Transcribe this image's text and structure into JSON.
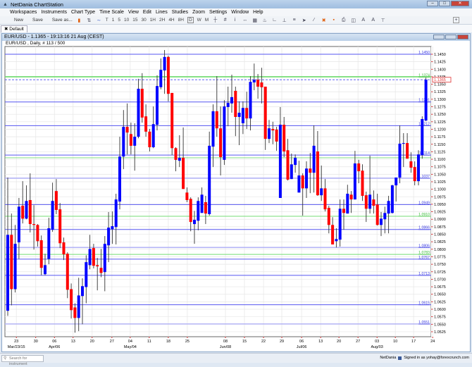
{
  "window": {
    "title": "NetDania ChartStation"
  },
  "menu": [
    "Workspaces",
    "Instruments",
    "Chart Type",
    "Time Scale",
    "View",
    "Edit",
    "Lines",
    "Studies",
    "Zoom",
    "Settings",
    "Window",
    "Help"
  ],
  "toolbar": {
    "new": "New",
    "save": "Save",
    "save_as": "Save as...",
    "timescales": [
      "T",
      "1",
      "5",
      "10",
      "15",
      "30",
      "1H",
      "2H",
      "4H",
      "8H",
      "D",
      "W",
      "M"
    ],
    "selected_timescale": "D"
  },
  "tab": {
    "label": "Default"
  },
  "chart_window": {
    "title": "EUR/USD - 1.1365 - 19:13:16  21 Aug (CEST)",
    "subtitle": "EUR/USD , Daily, # 113 / 500"
  },
  "status": {
    "search_placeholder": "Search for instrument",
    "brand": "NetDania",
    "signed_in": "Signed in as yohay@forexcrunch.com"
  },
  "colors": {
    "up": "#0000ff",
    "down": "#ff0000",
    "level": "#5c5cf0",
    "green_level": "#7ee07e",
    "grid": "#e6e6e6"
  },
  "chart_data": {
    "type": "candlestick",
    "instrument": "EUR/USD",
    "ylim": [
      1.0515,
      1.148
    ],
    "yticks": [
      "1.1450",
      "1.1425",
      "1.1400",
      "1.1375",
      "1.1350",
      "1.1325",
      "1.1300",
      "1.1275",
      "1.1250",
      "1.1225",
      "1.1200",
      "1.1175",
      "1.1150",
      "1.1125",
      "1.1100",
      "1.1075",
      "1.1050",
      "1.1025",
      "1.1000",
      "1.0975",
      "1.0950",
      "1.0925",
      "1.0900",
      "1.0875",
      "1.0850",
      "1.0825",
      "1.0800",
      "1.0775",
      "1.0750",
      "1.0725",
      "1.0700",
      "1.0675",
      "1.0650",
      "1.0625",
      "1.0600",
      "1.0575",
      "1.0550",
      "1.0525"
    ],
    "current_price": "1.1365",
    "levels": [
      {
        "value": "1.1450",
        "color": "blue"
      },
      {
        "value": "1.1374",
        "color": "green"
      },
      {
        "value": "1.1291",
        "color": "blue"
      },
      {
        "value": "1.1212",
        "color": "blue"
      },
      {
        "value": "1.1114",
        "color": "blue"
      },
      {
        "value": "1.1037",
        "color": "lightblue"
      },
      {
        "value": "1.0949",
        "color": "blue"
      },
      {
        "value": "1.0910",
        "color": "green"
      },
      {
        "value": "1.0866",
        "color": "blue"
      },
      {
        "value": "1.0806",
        "color": "lightblue"
      },
      {
        "value": "1.0783",
        "color": "green"
      },
      {
        "value": "1.0767",
        "color": "blue"
      },
      {
        "value": "1.0713",
        "color": "blue"
      },
      {
        "value": "1.0615",
        "color": "blue"
      },
      {
        "value": "1.0551",
        "color": "lightblue"
      }
    ],
    "xticks": [
      {
        "i": 2.3,
        "label": "23",
        "sub": "Mar/23/15"
      },
      {
        "i": 7.5,
        "label": "30"
      },
      {
        "i": 12.5,
        "label": "06",
        "sub": "Apr/06"
      },
      {
        "i": 17.5,
        "label": "13"
      },
      {
        "i": 22.6,
        "label": "20"
      },
      {
        "i": 27.9,
        "label": "27"
      },
      {
        "i": 32.8,
        "label": "04",
        "sub": "May/04"
      },
      {
        "i": 37.9,
        "label": "11"
      },
      {
        "i": 43,
        "label": "18"
      },
      {
        "i": 48.1,
        "label": "25"
      },
      {
        "i": 58.3,
        "label": "08",
        "sub": "Jun/08"
      },
      {
        "i": 63.4,
        "label": "15"
      },
      {
        "i": 68.5,
        "label": "22"
      },
      {
        "i": 73.4,
        "label": "29"
      },
      {
        "i": 78.7,
        "label": "06",
        "sub": "Jul/06"
      },
      {
        "i": 83.8,
        "label": "13"
      },
      {
        "i": 88.7,
        "label": "20"
      },
      {
        "i": 93.8,
        "label": "27"
      },
      {
        "i": 98.9,
        "label": "03",
        "sub": "Aug/03"
      },
      {
        "i": 103.8,
        "label": "10"
      },
      {
        "i": 108.7,
        "label": "17"
      },
      {
        "i": 113.8,
        "label": "24"
      }
    ],
    "ohlc": [
      [
        1.0595,
        1.1039,
        1.0578,
        1.0848
      ],
      [
        1.0848,
        1.0919,
        1.0613,
        1.0667
      ],
      [
        1.0667,
        1.0881,
        1.0656,
        1.0818
      ],
      [
        1.0823,
        1.0971,
        1.0768,
        1.0942
      ],
      [
        1.0945,
        1.1027,
        1.0886,
        1.0902
      ],
      [
        1.0902,
        1.1013,
        1.09,
        1.0961
      ],
      [
        1.0964,
        1.1053,
        1.0856,
        1.0884
      ],
      [
        1.0884,
        1.0947,
        1.0799,
        1.0881
      ],
      [
        1.0881,
        1.0884,
        1.0809,
        1.0827
      ],
      [
        1.083,
        1.0846,
        1.0714,
        1.0738
      ],
      [
        1.0717,
        1.0785,
        1.0714,
        1.0747
      ],
      [
        1.0768,
        1.0905,
        1.075,
        1.087
      ],
      [
        1.0865,
        1.1022,
        1.0858,
        1.0961
      ],
      [
        1.0994,
        1.1034,
        1.0917,
        1.0931
      ],
      [
        1.0933,
        1.0954,
        1.0804,
        1.082
      ],
      [
        1.0823,
        1.0839,
        1.0764,
        1.0783
      ],
      [
        1.0785,
        1.079,
        1.0637,
        1.0665
      ],
      [
        1.0667,
        1.0686,
        1.0569,
        1.0597
      ],
      [
        1.0606,
        1.062,
        1.0522,
        1.0571
      ],
      [
        1.0571,
        1.0705,
        1.0527,
        1.0646
      ],
      [
        1.0644,
        1.0703,
        1.055,
        1.0677
      ],
      [
        1.0674,
        1.078,
        1.062,
        1.0757
      ],
      [
        1.0747,
        1.0848,
        1.0733,
        1.0801
      ],
      [
        1.0804,
        1.0818,
        1.0736,
        1.0745
      ],
      [
        1.0747,
        1.0771,
        1.0663,
        1.0743
      ],
      [
        1.0738,
        1.0801,
        1.0707,
        1.0721
      ],
      [
        1.0724,
        1.0844,
        1.066,
        1.0818
      ],
      [
        1.0813,
        1.0924,
        1.0757,
        1.0872
      ],
      [
        1.0867,
        1.0926,
        1.0818,
        1.0877
      ],
      [
        1.0874,
        1.0985,
        1.0816,
        1.0966
      ],
      [
        1.0959,
        1.1175,
        1.0933,
        1.1109
      ],
      [
        1.1109,
        1.1264,
        1.1067,
        1.1208
      ],
      [
        1.1208,
        1.1286,
        1.1116,
        1.1189
      ],
      [
        1.1184,
        1.1222,
        1.1116,
        1.1145
      ],
      [
        1.1145,
        1.122,
        1.1062,
        1.1175
      ],
      [
        1.1175,
        1.1368,
        1.117,
        1.1335
      ],
      [
        1.1335,
        1.1387,
        1.1222,
        1.1239
      ],
      [
        1.1243,
        1.1283,
        1.1175,
        1.1192
      ],
      [
        1.1192,
        1.1201,
        1.1126,
        1.114
      ],
      [
        1.114,
        1.1276,
        1.1137,
        1.1217
      ],
      [
        1.1215,
        1.138,
        1.1196,
        1.1344
      ],
      [
        1.134,
        1.1436,
        1.1333,
        1.1398
      ],
      [
        1.1396,
        1.1464,
        1.1318,
        1.1441
      ],
      [
        1.1441,
        1.1445,
        1.1293,
        1.1318
      ],
      [
        1.1321,
        1.1321,
        1.1114,
        1.1137
      ],
      [
        1.1137,
        1.114,
        1.106,
        1.1098
      ],
      [
        1.1095,
        1.118,
        1.1074,
        1.1105
      ],
      [
        1.1105,
        1.1206,
        1.1001,
        1.1001
      ],
      [
        1.0989,
        1.1006,
        1.0957,
        1.0964
      ],
      [
        1.0968,
        1.0973,
        1.086,
        1.0891
      ],
      [
        1.0884,
        1.0928,
        1.0818,
        1.0898
      ],
      [
        1.0895,
        1.0973,
        1.0863,
        1.0961
      ],
      [
        1.0921,
        1.1006,
        1.0921,
        1.0982
      ],
      [
        1.0957,
        1.0978,
        1.0884,
        1.0919
      ],
      [
        1.0917,
        1.1192,
        1.0912,
        1.1145
      ],
      [
        1.1142,
        1.1283,
        1.1074,
        1.126
      ],
      [
        1.126,
        1.1377,
        1.1175,
        1.1203
      ],
      [
        1.1203,
        1.1276,
        1.1046,
        1.1107
      ],
      [
        1.1098,
        1.1297,
        1.1081,
        1.1276
      ],
      [
        1.1274,
        1.1342,
        1.121,
        1.1288
      ],
      [
        1.1286,
        1.1382,
        1.1255,
        1.1307
      ],
      [
        1.1328,
        1.1342,
        1.1177,
        1.1241
      ],
      [
        1.1241,
        1.1293,
        1.1147,
        1.1255
      ],
      [
        1.122,
        1.1293,
        1.1184,
        1.1271
      ],
      [
        1.1271,
        1.1325,
        1.1201,
        1.1236
      ],
      [
        1.1236,
        1.1377,
        1.1196,
        1.1358
      ],
      [
        1.1356,
        1.1419,
        1.133,
        1.1365
      ],
      [
        1.1365,
        1.1384,
        1.1302,
        1.1342
      ],
      [
        1.1356,
        1.1405,
        1.1286,
        1.134
      ],
      [
        1.1342,
        1.1342,
        1.1131,
        1.1168
      ],
      [
        1.1168,
        1.1231,
        1.1154,
        1.1203
      ],
      [
        1.1201,
        1.1225,
        1.115,
        1.1196
      ],
      [
        1.1199,
        1.1208,
        1.1128,
        1.1159
      ],
      [
        1.0971,
        1.1274,
        1.0971,
        1.1215
      ],
      [
        1.1215,
        1.1241,
        1.1107,
        1.1126
      ],
      [
        1.113,
        1.1168,
        1.1029,
        1.1032
      ],
      [
        1.1034,
        1.1119,
        1.1034,
        1.1083
      ],
      [
        1.1081,
        1.1116,
        1.1055,
        1.1105
      ],
      [
        1.0989,
        1.1095,
        1.0989,
        1.1046
      ],
      [
        1.1046,
        1.1053,
        1.0912,
        1.1003
      ],
      [
        1.1003,
        1.1093,
        1.0971,
        1.1069
      ],
      [
        1.1069,
        1.1121,
        1.0987,
        1.1055
      ],
      [
        1.1055,
        1.1213,
        1.0989,
        1.1145
      ],
      [
        1.1126,
        1.1194,
        1.0978,
        1.098
      ],
      [
        1.098,
        1.1079,
        1.0961,
        1.1003
      ],
      [
        1.1003,
        1.1034,
        1.0926,
        1.0933
      ],
      [
        1.0938,
        1.0945,
        1.0853,
        1.0881
      ],
      [
        1.0881,
        1.0907,
        1.0816,
        1.0816
      ],
      [
        1.0827,
        1.087,
        1.0806,
        1.0834
      ],
      [
        1.0832,
        1.0966,
        1.0809,
        1.0935
      ],
      [
        1.0935,
        1.0966,
        1.0865,
        1.0921
      ],
      [
        1.0919,
        1.1015,
        1.0919,
        1.0985
      ],
      [
        1.0982,
        1.0994,
        1.0921,
        1.0966
      ],
      [
        1.0966,
        1.1128,
        1.0966,
        1.1086
      ],
      [
        1.1086,
        1.1098,
        1.102,
        1.106
      ],
      [
        1.1062,
        1.1083,
        1.0961,
        1.0978
      ],
      [
        1.098,
        1.0992,
        1.0891,
        1.0935
      ],
      [
        1.0935,
        1.1112,
        1.0919,
        1.0982
      ],
      [
        1.0966,
        1.0996,
        1.0919,
        1.0945
      ],
      [
        1.0949,
        1.0985,
        1.0879,
        1.0881
      ],
      [
        1.0881,
        1.0924,
        1.0844,
        1.0902
      ],
      [
        1.09,
        1.0942,
        1.0853,
        1.0921
      ],
      [
        1.0919,
        1.0978,
        1.0853,
        1.0961
      ],
      [
        1.0921,
        1.1015,
        1.0919,
        1.1013
      ],
      [
        1.1013,
        1.1039,
        1.0959,
        1.1039
      ],
      [
        1.1039,
        1.1213,
        1.102,
        1.1152
      ],
      [
        1.1152,
        1.1187,
        1.1074,
        1.1154
      ],
      [
        1.1154,
        1.1187,
        1.1102,
        1.1102
      ],
      [
        1.1093,
        1.1123,
        1.1055,
        1.1072
      ],
      [
        1.1074,
        1.1093,
        1.1013,
        1.1027
      ],
      [
        1.1027,
        1.113,
        1.1013,
        1.1116
      ],
      [
        1.1114,
        1.1243,
        1.1102,
        1.1234
      ],
      [
        1.1229,
        1.1372,
        1.1227,
        1.1365
      ]
    ]
  }
}
